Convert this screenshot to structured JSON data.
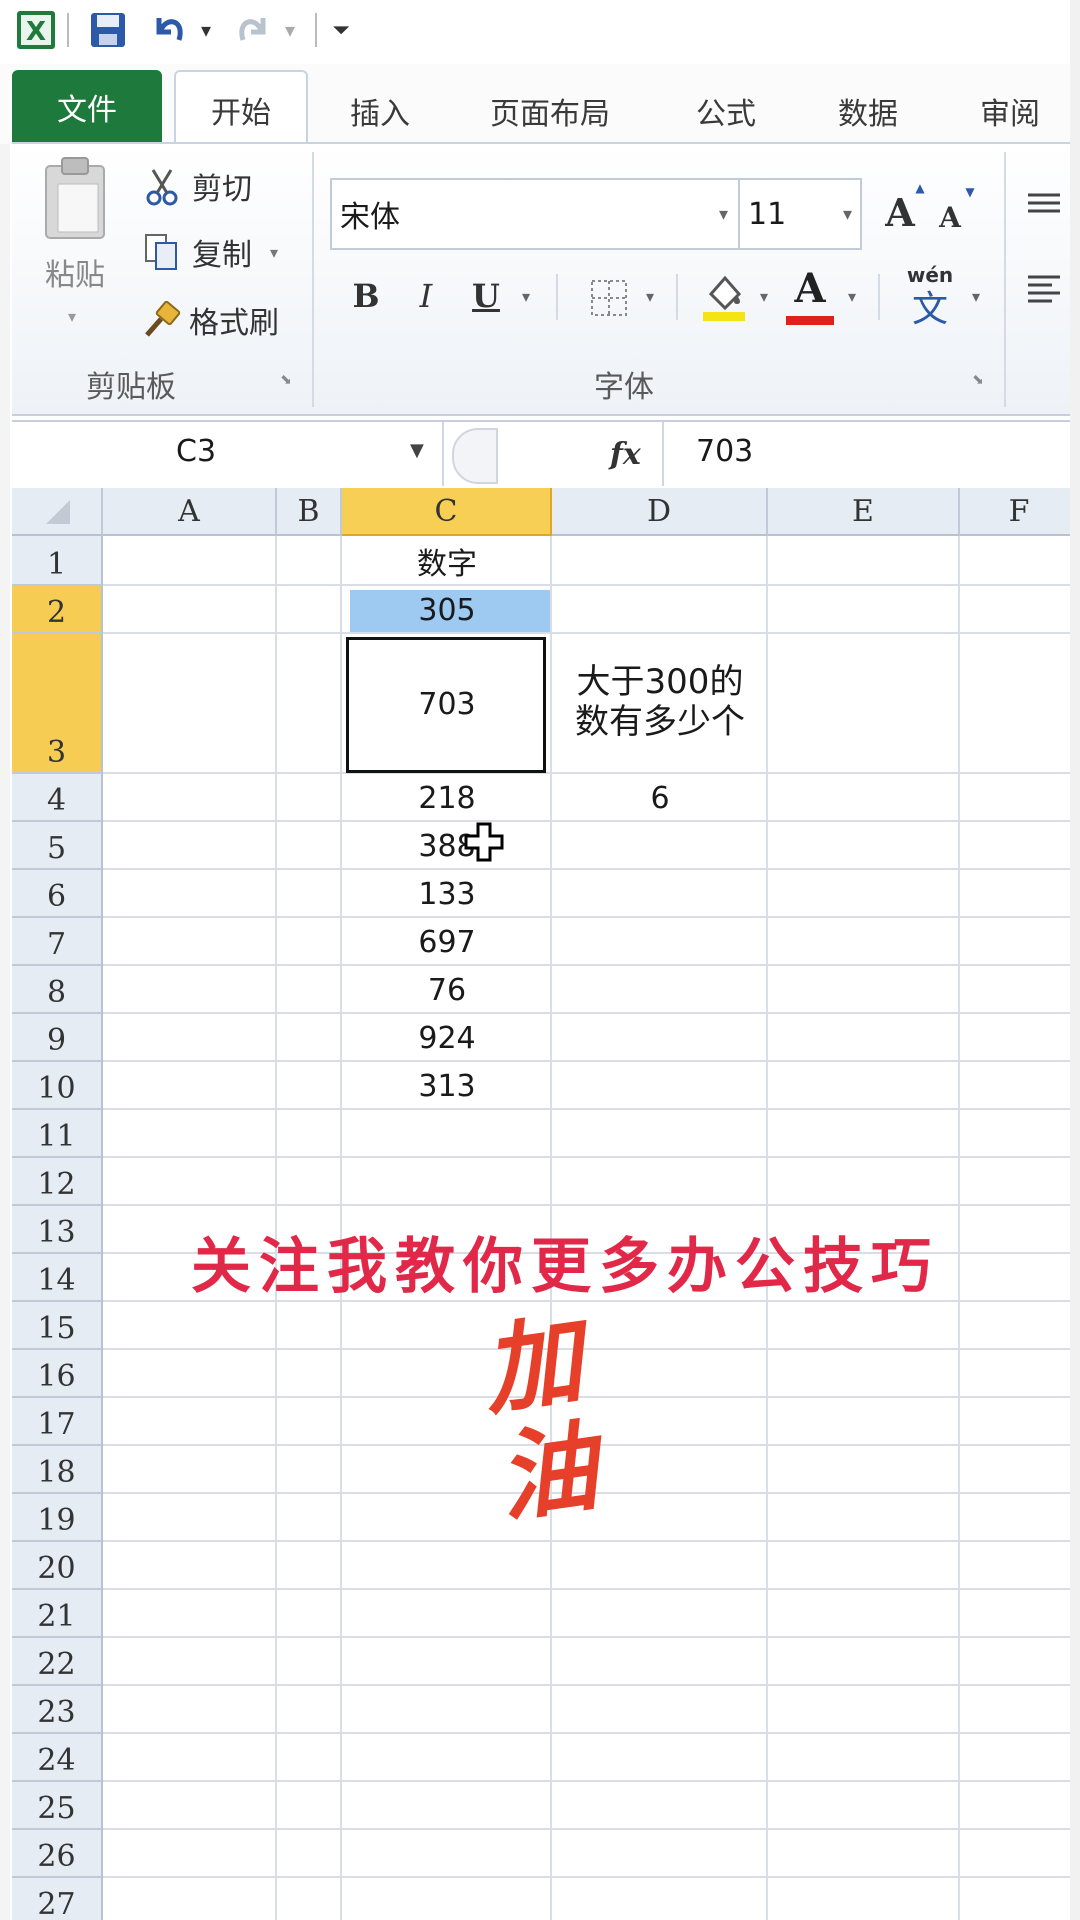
{
  "quick_access": {
    "undo_dropdown": "▾",
    "redo_dropdown": "▾",
    "customize": "⏷"
  },
  "tabs": [
    "文件",
    "开始",
    "插入",
    "页面布局",
    "公式",
    "数据",
    "审阅"
  ],
  "ribbon": {
    "clipboard": {
      "paste_label": "粘贴",
      "cut_label": "剪切",
      "copy_label": "复制",
      "format_painter_label": "格式刷",
      "group_label": "剪贴板"
    },
    "font": {
      "font_name": "宋体",
      "font_size": "11",
      "grow_label": "A",
      "shrink_label": "A",
      "bold": "B",
      "italic": "I",
      "underline": "U",
      "font_color_label": "A",
      "phonetic_label": "wén",
      "phonetic_glyph": "文",
      "group_label": "字体"
    }
  },
  "formula_bar": {
    "name_box": "C3",
    "fx_label": "fx",
    "value": "703"
  },
  "sheet": {
    "columns": [
      "A",
      "B",
      "C",
      "D",
      "E",
      "F"
    ],
    "rows": [
      "1",
      "2",
      "3",
      "4",
      "5",
      "6",
      "7",
      "8",
      "9",
      "10",
      "11",
      "12",
      "13",
      "14",
      "15",
      "16",
      "17",
      "18",
      "19",
      "20",
      "21",
      "22",
      "23",
      "24",
      "25",
      "26",
      "27"
    ],
    "selected_cell": "C3",
    "cells": {
      "C1": "数字",
      "C2": "305",
      "C3": "703",
      "D3_line1": "大于300的",
      "D3_line2": "数有多少个",
      "C4": "218",
      "D4": "6",
      "C5": "388",
      "C6": "133",
      "C7": "697",
      "C8": "76",
      "C9": "924",
      "C10": "313"
    }
  },
  "overlay": {
    "caption": "关注我教你更多办公技巧",
    "sticker_line1": "加",
    "sticker_line2": "油"
  },
  "colors": {
    "file_tab": "#1d7a3c",
    "selection_header": "#f6cf54",
    "caption": "#e12848",
    "sticker": "#e6402a",
    "highlight_fill": "#9ec9f0"
  }
}
